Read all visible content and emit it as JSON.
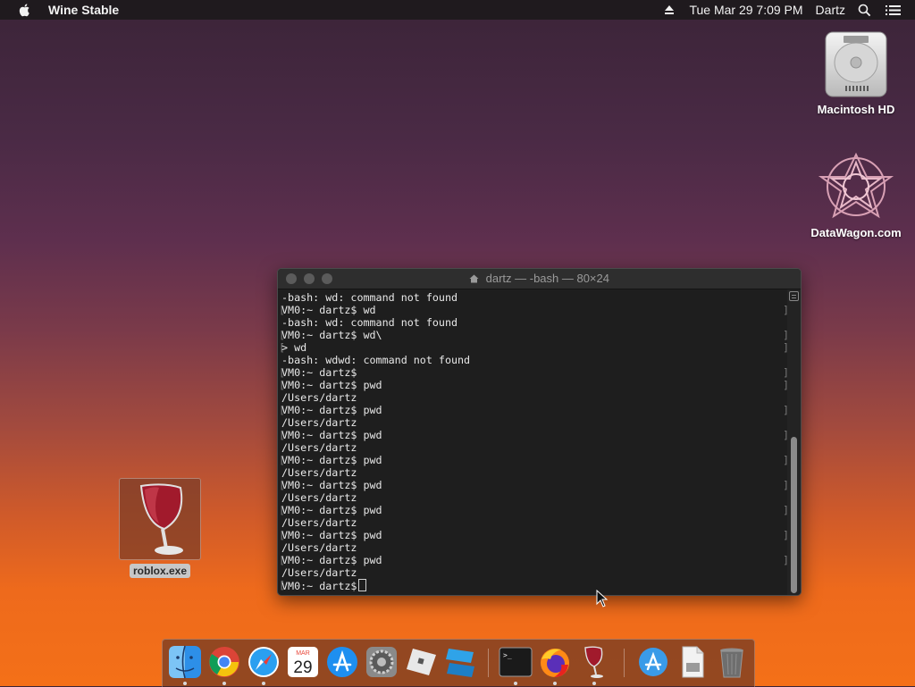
{
  "menubar": {
    "app_name": "Wine Stable",
    "clock": "Tue Mar 29  7:09 PM",
    "user": "Dartz",
    "icons": [
      "apple-icon",
      "eject-icon",
      "spotlight-icon",
      "menu-list-icon"
    ]
  },
  "desktop": {
    "macintosh_hd": "Macintosh HD",
    "datawagon": "DataWagon.com",
    "roblox": "roblox.exe"
  },
  "terminal": {
    "title": "dartz — -bash — 80×24",
    "lines": [
      "-bash: wd: command not found",
      "VM0:~ dartz$ wd",
      "-bash: wd: command not found",
      "VM0:~ dartz$ wd\\",
      "> wd",
      "-bash: wdwd: command not found",
      "VM0:~ dartz$",
      "VM0:~ dartz$ pwd",
      "/Users/dartz",
      "VM0:~ dartz$ pwd",
      "/Users/dartz",
      "VM0:~ dartz$ pwd",
      "/Users/dartz",
      "VM0:~ dartz$ pwd",
      "/Users/dartz",
      "VM0:~ dartz$ pwd",
      "/Users/dartz",
      "VM0:~ dartz$ pwd",
      "/Users/dartz",
      "VM0:~ dartz$ pwd",
      "/Users/dartz",
      "VM0:~ dartz$ pwd",
      "/Users/dartz",
      "VM0:~ dartz$"
    ]
  },
  "dock": {
    "calendar_month": "MAR",
    "calendar_day": "29",
    "items": [
      "finder-icon",
      "chrome-icon",
      "safari-icon",
      "calendar-icon",
      "app-store-icon",
      "system-preferences-icon",
      "roblox-icon",
      "roblox-studio-icon",
      "terminal-icon",
      "firefox-icon",
      "wine-icon",
      "app-store-downloads-icon",
      "document-icon",
      "trash-icon"
    ]
  }
}
